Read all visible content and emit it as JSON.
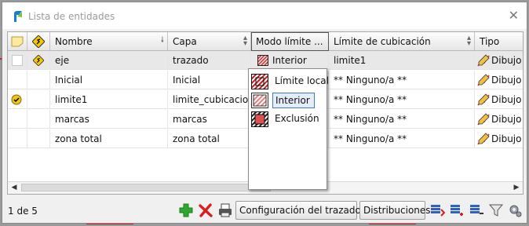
{
  "window": {
    "title": "Lista de entidades"
  },
  "columns": [
    "Nombre",
    "Capa",
    "Modo límite ...",
    "Límite de cubicación",
    "Tipo"
  ],
  "rows": [
    {
      "nombre": "eje",
      "capa": "trazado",
      "modo": "Interior",
      "limite": "limite1",
      "tipo": "Dibujo e",
      "selected": true,
      "check": false
    },
    {
      "nombre": "Inicial",
      "capa": "Inicial",
      "modo": "",
      "limite": "** Ninguno/a **",
      "tipo": "Dibujo e",
      "selected": false,
      "check": false
    },
    {
      "nombre": "limite1",
      "capa": "limite_cubicacion",
      "modo": "",
      "limite": "** Ninguno/a **",
      "tipo": "Dibujo e",
      "selected": false,
      "check": true
    },
    {
      "nombre": "marcas",
      "capa": "marcas",
      "modo": "",
      "limite": "** Ninguno/a **",
      "tipo": "Dibujo e",
      "selected": false,
      "check": false
    },
    {
      "nombre": "zona total",
      "capa": "zona total",
      "modo": "",
      "limite": "** Ninguno/a **",
      "tipo": "Dibujo e",
      "selected": false,
      "check": false
    }
  ],
  "dropdown": {
    "options": [
      "Límite local",
      "Interior",
      "Exclusión"
    ],
    "hovered": "Interior"
  },
  "status": {
    "count": "1 de 5"
  },
  "buttons": {
    "config": "Configuración del trazado...",
    "distribuciones": "Distribuciones"
  },
  "colors": {
    "check": "#f2c418",
    "warning": "#f5c800",
    "accent": "#3c78c8",
    "add": "#2fa82f",
    "delete": "#d81e1e"
  }
}
